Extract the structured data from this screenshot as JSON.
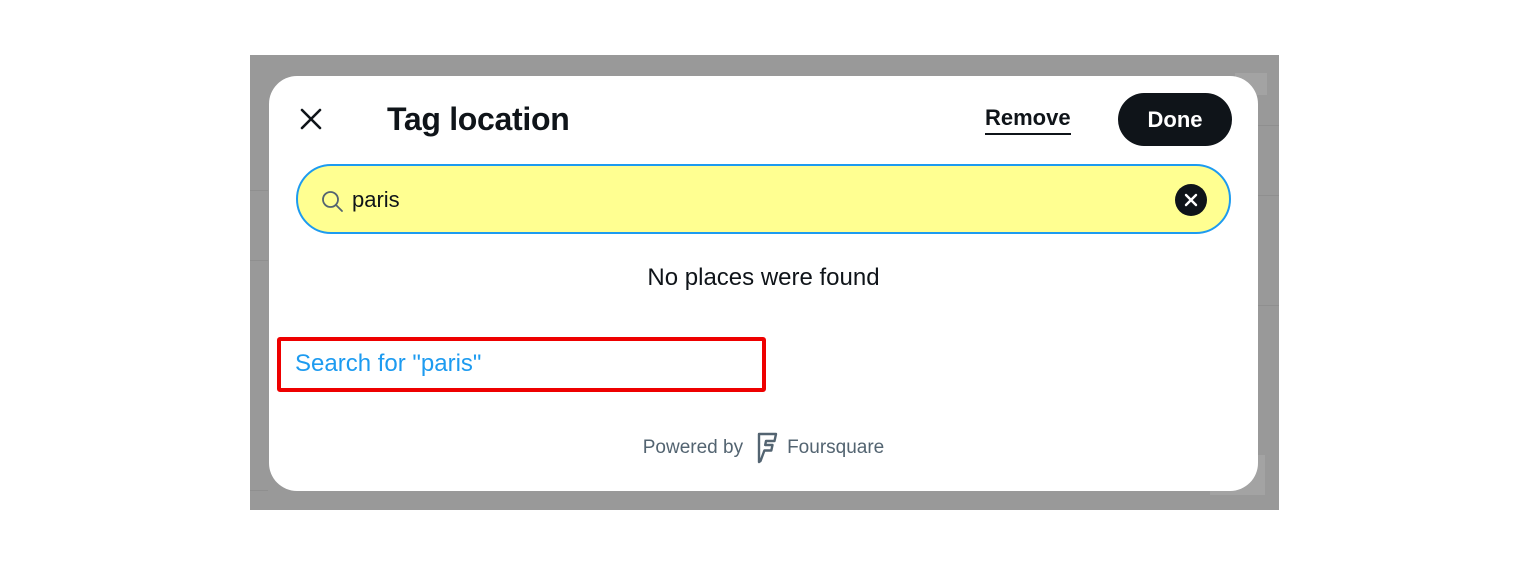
{
  "modal": {
    "title": "Tag location",
    "remove_label": "Remove",
    "done_label": "Done"
  },
  "search": {
    "value": "paris",
    "border_color": "#1d9bf0",
    "background_color": "#ffff91"
  },
  "results": {
    "empty_message": "No places were found",
    "search_for_link": "Search for \"paris\""
  },
  "footer": {
    "powered_by": "Powered by",
    "provider": "Foursquare",
    "provider_icon": "foursquare-logo-icon"
  },
  "icons": {
    "close": "close-icon",
    "search": "search-icon",
    "clear": "clear-icon"
  },
  "colors": {
    "accent": "#1d9bf0",
    "primary_text": "#0f1419",
    "secondary_text": "#536471",
    "highlight": "#ee0000",
    "overlay": "#999999"
  }
}
